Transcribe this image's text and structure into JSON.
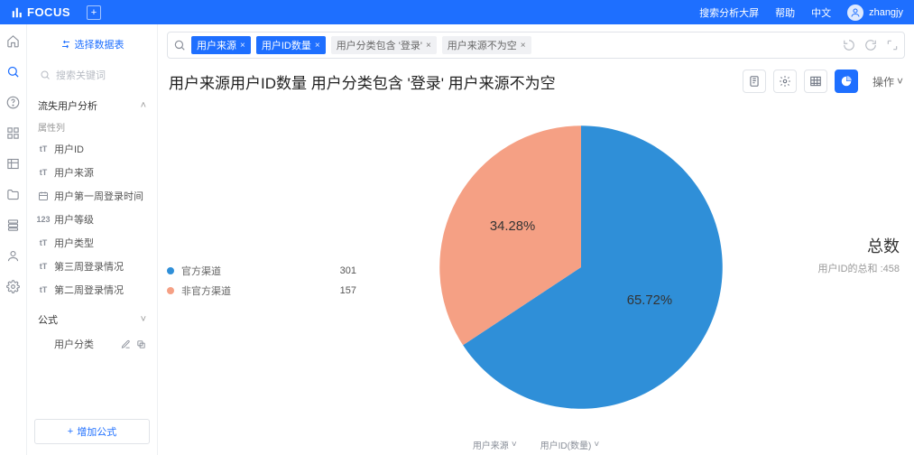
{
  "app": {
    "name": "FOCUS"
  },
  "topbar": {
    "links": [
      "搜索分析大屏",
      "帮助",
      "中文"
    ],
    "user": "zhangjy"
  },
  "sidebar": {
    "select_ds": "选择数据表",
    "search_placeholder": "搜索关键词",
    "group": "流失用户分析",
    "attr_section": "属性列",
    "attrs": [
      "用户ID",
      "用户来源",
      "用户第一周登录时间",
      "用户等级",
      "用户类型",
      "第三周登录情况",
      "第二周登录情况"
    ],
    "formula_section": "公式",
    "formula_items": [
      "用户分类"
    ],
    "add_formula": "增加公式"
  },
  "tagbar": {
    "tags": [
      {
        "label": "用户来源",
        "style": "blue"
      },
      {
        "label": "用户ID数量",
        "style": "blue"
      },
      {
        "label": "用户分类包含 '登录'",
        "style": "grey"
      },
      {
        "label": "用户来源不为空",
        "style": "grey"
      }
    ]
  },
  "title": "用户来源用户ID数量 用户分类包含 '登录'  用户来源不为空",
  "ops_label": "操作",
  "summary": {
    "title": "总数",
    "sub": "用户ID的总和 :458"
  },
  "footer": {
    "left": "用户来源",
    "right": "用户ID(数量)"
  },
  "chart_data": {
    "type": "pie",
    "title": "用户来源用户ID数量 用户分类包含 '登录'  用户来源不为空",
    "series": [
      {
        "name": "官方渠道",
        "value": 301,
        "percent": 65.72,
        "color": "#2f8fd8"
      },
      {
        "name": "非官方渠道",
        "value": 157,
        "percent": 34.28,
        "color": "#f5a084"
      }
    ],
    "total": 458
  }
}
